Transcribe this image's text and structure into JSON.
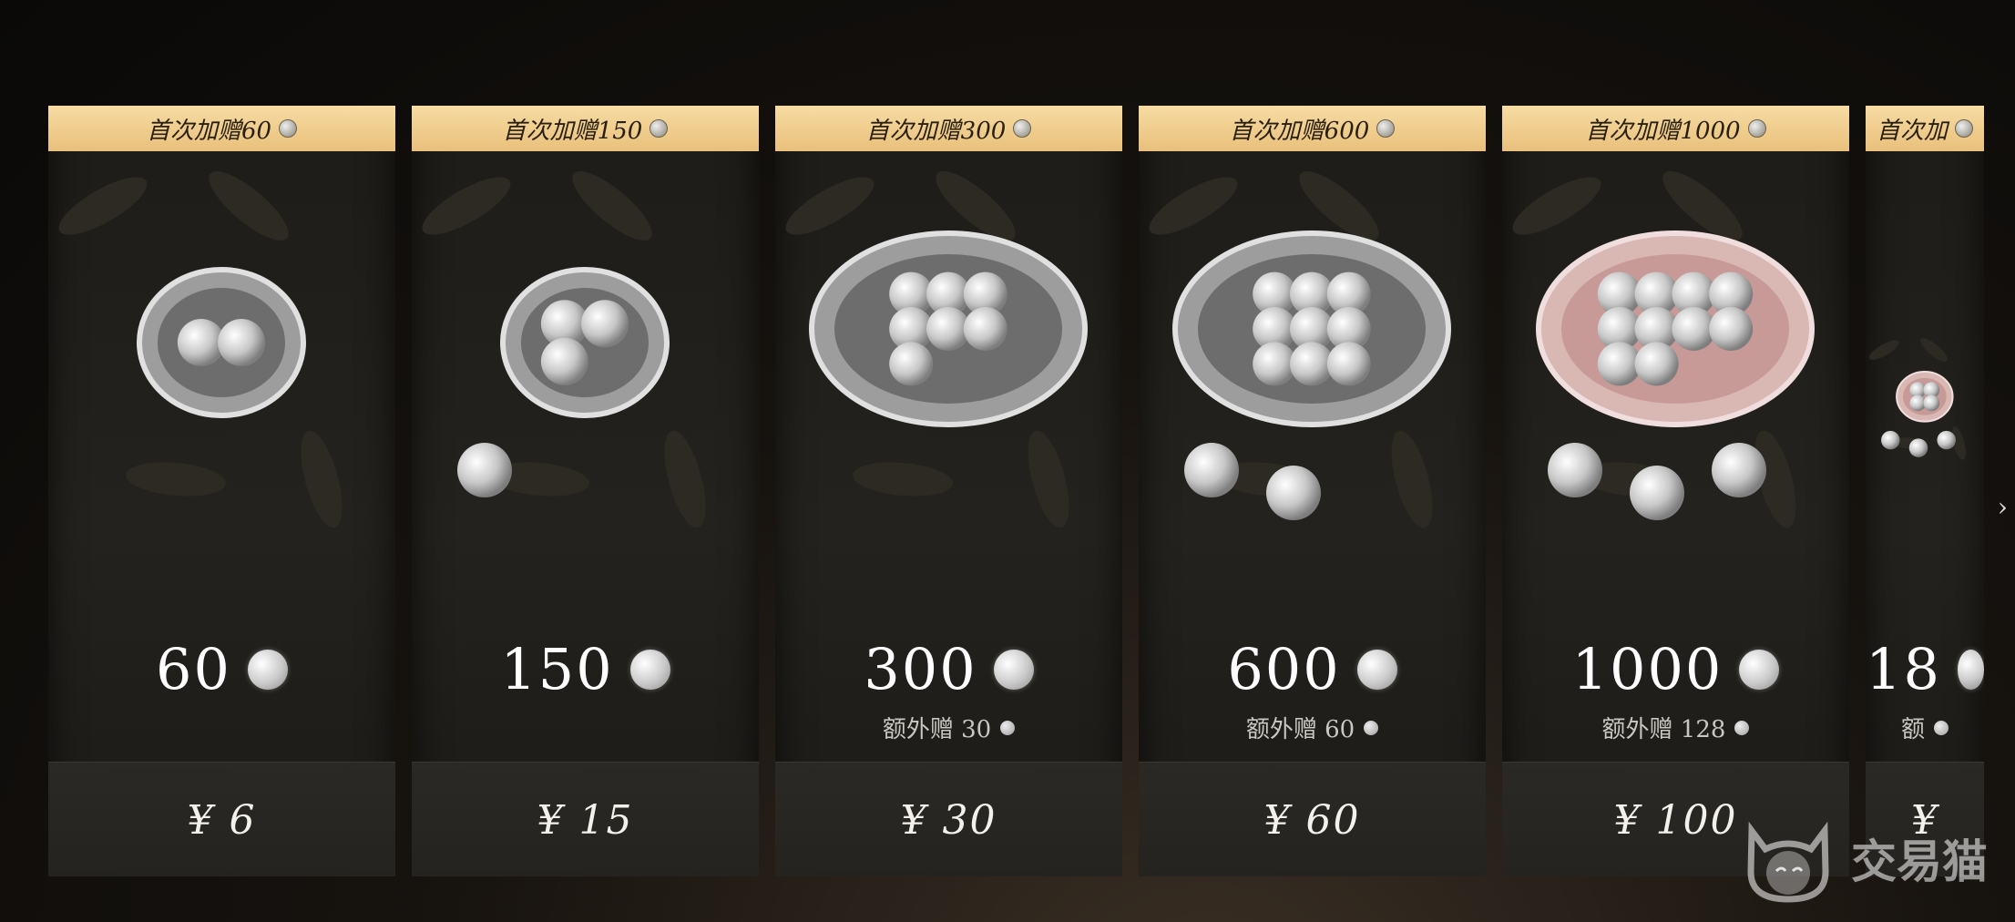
{
  "cards": [
    {
      "banner": "首次加赠60",
      "amount": "60",
      "bonus": "",
      "price": "¥ 6",
      "shells": 1,
      "pearls": 2,
      "loose": 0,
      "pink": false
    },
    {
      "banner": "首次加赠150",
      "amount": "150",
      "bonus": "",
      "price": "¥ 15",
      "shells": 1,
      "pearls": 3,
      "loose": 1,
      "pink": false
    },
    {
      "banner": "首次加赠300",
      "amount": "300",
      "bonus": "额外赠 30",
      "price": "¥ 30",
      "shells": 1,
      "pearls": 7,
      "loose": 0,
      "pink": false
    },
    {
      "banner": "首次加赠600",
      "amount": "600",
      "bonus": "额外赠 60",
      "price": "¥ 60",
      "shells": 1,
      "pearls": 9,
      "loose": 2,
      "pink": false
    },
    {
      "banner": "首次加赠1000",
      "amount": "1000",
      "bonus": "额外赠 128",
      "price": "¥ 100",
      "shells": 1,
      "pearls": 10,
      "loose": 3,
      "pink": true
    },
    {
      "banner": "首次加",
      "amount": "18",
      "bonus": "额",
      "price": "¥",
      "shells": 1,
      "pearls": 4,
      "loose": 3,
      "pink": true
    }
  ],
  "watermark": {
    "text": "交易猫",
    "icon": "cat-icon"
  },
  "colors": {
    "banner": "#f2d195",
    "card": "#22201c",
    "pearl": "#d9d9d9"
  }
}
